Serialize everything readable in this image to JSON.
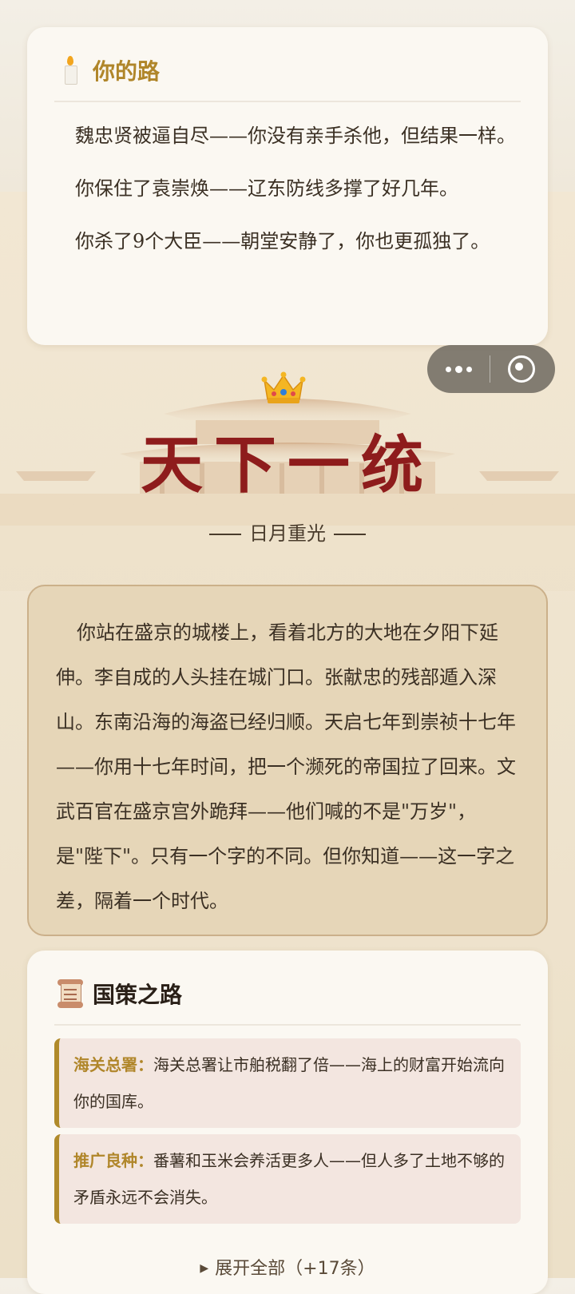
{
  "path_card": {
    "title": "你的路",
    "icon": "candle-icon",
    "paragraphs": [
      "魏忠贤被逼自尽——你没有亲手杀他，但结果一样。",
      "你保住了袁崇焕——辽东防线多撑了好几年。",
      "你杀了9个大臣——朝堂安静了，你也更孤独了。"
    ]
  },
  "capsule": {
    "more_icon": "more-dots-icon",
    "close_icon": "target-icon"
  },
  "ending": {
    "icon": "crown-icon",
    "title": "天下一统",
    "subtitle": "日月重光"
  },
  "story": {
    "text": "你站在盛京的城楼上，看着北方的大地在夕阳下延伸。李自成的人头挂在城门口。张献忠的残部遁入深山。东南沿海的海盗已经归顺。天启七年到崇祯十七年——你用十七年时间，把一个濒死的帝国拉了回来。文武百官在盛京宫外跪拜——他们喊的不是\"万岁\"，是\"陛下\"。只有一个字的不同。但你知道——这一字之差，隔着一个时代。"
  },
  "policy_card": {
    "title": "国策之路",
    "icon": "scroll-icon",
    "items": [
      {
        "name": "海关总署：",
        "text": "海关总署让市舶税翻了倍——海上的财富开始流向你的国库。"
      },
      {
        "name": "推广良种：",
        "text": "番薯和玉米会养活更多人——但人多了土地不够的矛盾永远不会消失。"
      }
    ],
    "expand_label": "展开全部（+17条）"
  },
  "colors": {
    "gold": "#b0862a",
    "ending_red": "#8e1c1c",
    "story_bg": "#e6d6b8"
  }
}
